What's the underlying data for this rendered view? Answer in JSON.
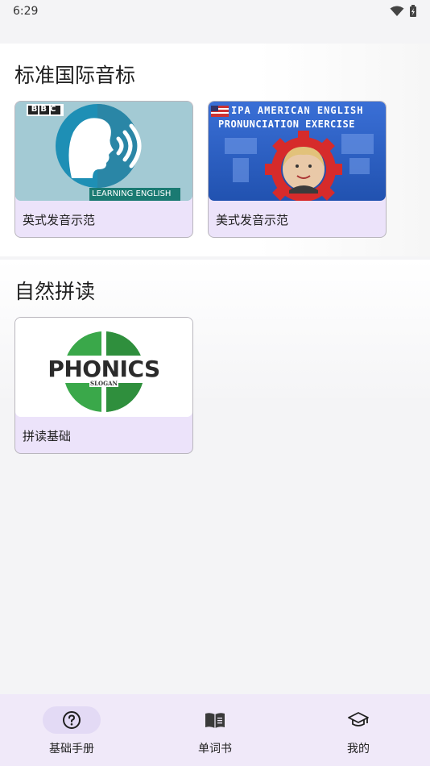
{
  "status": {
    "time": "6:29"
  },
  "sections": [
    {
      "title": "标准国际音标",
      "cards": [
        {
          "label": "英式发音示范",
          "thumb_badge": "BBC",
          "thumb_caption": "LEARNING ENGLISH"
        },
        {
          "label": "美式发音示范",
          "thumb_line1": "IPA AMERICAN ENGLISH",
          "thumb_line2": "PRONUNCIATION EXERCISE"
        }
      ]
    },
    {
      "title": "自然拼读",
      "cards": [
        {
          "label": "拼读基础",
          "thumb_word": "PHONICS",
          "thumb_sub": "SLOGAN"
        }
      ]
    }
  ],
  "nav": {
    "items": [
      {
        "label": "基础手册",
        "icon": "help-circle-icon",
        "active": true
      },
      {
        "label": "单词书",
        "icon": "book-open-icon",
        "active": false
      },
      {
        "label": "我的",
        "icon": "graduation-cap-icon",
        "active": false
      }
    ]
  },
  "colors": {
    "accent_pill": "#e3daf5",
    "card_bg": "#ece3fa",
    "nav_bg": "#f0e9f9"
  }
}
